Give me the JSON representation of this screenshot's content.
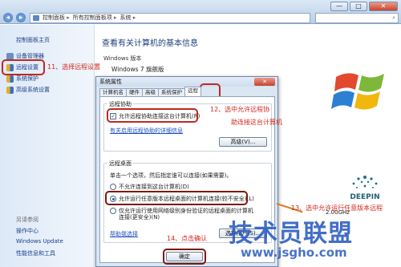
{
  "titlebar": {
    "minimize": "—",
    "maximize": "□",
    "close": "✕"
  },
  "address": {
    "crumbs": [
      "控制面板",
      "所有控制面板项",
      "系统"
    ],
    "search_glyph": "⌕"
  },
  "sidebar": {
    "home": "控制面板主页",
    "items": [
      {
        "label": "设备管理器",
        "icon": "device-manager-icon"
      },
      {
        "label": "远程设置",
        "icon": "shield-icon"
      },
      {
        "label": "系统保护",
        "icon": "shield-icon"
      },
      {
        "label": "高级系统设置",
        "icon": "shield-icon"
      }
    ],
    "see_also": "另请参阅",
    "see_links": [
      "操作中心",
      "Windows Update",
      "性能信息和工具"
    ]
  },
  "main": {
    "title": "查看有关计算机的基本信息",
    "edition_label": "Windows 版本",
    "edition_value": "Windows 7 旗舰版",
    "logo_text": "DEEPIN",
    "freq": "2.00GHz",
    "freq_unit": "2.00 GHz"
  },
  "dialog": {
    "title": "系统属性",
    "tabs": [
      "计算机名",
      "硬件",
      "高级",
      "系统保护",
      "远程"
    ],
    "active_tab": 4,
    "assist_group": "远程协助",
    "assist_check": "允许远程协助连接这台计算机(R)",
    "assist_link": "有关启用远程协助的详细信息",
    "advanced_btn": "高级(V)...",
    "desktop_group": "远程桌面",
    "desktop_hint": "单击一个选项，然后指定谁可以连接(如果需要)。",
    "radio1": "不允许连接到这台计算机(D)",
    "radio2": "允许运行任意版本远程桌面的计算机连接(较不安全)(L)",
    "radio3a": "仅允许运行使用网络级别身份验证的远程桌面的计算机",
    "radio3b": "连接(更安全)(N)",
    "help_link": "帮助我选择",
    "select_user_btn": "选择用户(S)...",
    "ok_btn": "确定"
  },
  "annotations": {
    "step11": "11、选择远程设置",
    "step12a": "12、选中允许远程协",
    "step12b": "助连接这台计算机",
    "step13": "13、选中允许运行任意版本远程",
    "step14": "14、点击确认"
  },
  "watermark": {
    "text": "技术员联盟",
    "url": "www.jsgho.com"
  },
  "colors": {
    "accent": "#1a3e8c",
    "annotation": "#d1281d",
    "highlight_box": "#c0281f"
  }
}
